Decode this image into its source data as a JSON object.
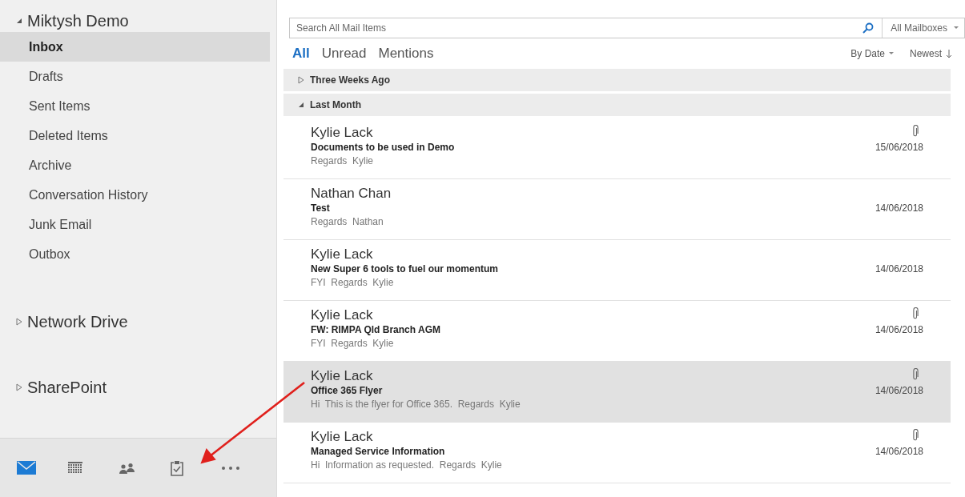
{
  "sidebar": {
    "accounts": [
      {
        "name": "Miktysh Demo",
        "expanded": true,
        "folders": [
          {
            "label": "Inbox",
            "selected": true
          },
          {
            "label": "Drafts",
            "selected": false
          },
          {
            "label": "Sent Items",
            "selected": false
          },
          {
            "label": "Deleted Items",
            "selected": false
          },
          {
            "label": "Archive",
            "selected": false
          },
          {
            "label": "Conversation History",
            "selected": false
          },
          {
            "label": "Junk Email",
            "selected": false
          },
          {
            "label": "Outbox",
            "selected": false
          }
        ]
      },
      {
        "name": "Network Drive",
        "expanded": false
      },
      {
        "name": "SharePoint",
        "expanded": false
      }
    ]
  },
  "nav_bar": [
    {
      "kind": "mail",
      "selected": true
    },
    {
      "kind": "calendar",
      "selected": false
    },
    {
      "kind": "people",
      "selected": false
    },
    {
      "kind": "tasks",
      "selected": false
    },
    {
      "kind": "more",
      "selected": false
    }
  ],
  "search": {
    "placeholder": "Search All Mail Items",
    "scope": "All Mailboxes"
  },
  "filters": [
    {
      "label": "All",
      "selected": true
    },
    {
      "label": "Unread",
      "selected": false
    },
    {
      "label": "Mentions",
      "selected": false
    }
  ],
  "sort": {
    "by": "By Date",
    "order": "Newest"
  },
  "groups": [
    {
      "label": "Three Weeks Ago",
      "expanded": false
    },
    {
      "label": "Last Month",
      "expanded": true,
      "messages": [
        {
          "sender": "Kylie Lack",
          "subject": "Documents to be used in Demo",
          "preview": "Regards  Kylie",
          "date": "15/06/2018",
          "attachment": true,
          "selected": false
        },
        {
          "sender": "Nathan Chan",
          "subject": "Test",
          "preview": "Regards  Nathan",
          "date": "14/06/2018",
          "attachment": false,
          "selected": false
        },
        {
          "sender": "Kylie Lack",
          "subject": "New Super 6 tools to fuel our momentum",
          "preview": "FYI  Regards  Kylie",
          "date": "14/06/2018",
          "attachment": false,
          "selected": false
        },
        {
          "sender": "Kylie Lack",
          "subject": "FW: RIMPA Qld Branch AGM",
          "preview": "FYI  Regards  Kylie",
          "date": "14/06/2018",
          "attachment": true,
          "selected": false
        },
        {
          "sender": "Kylie Lack",
          "subject": "Office 365 Flyer",
          "preview": "Hi  This is the flyer for Office 365.  Regards  Kylie",
          "date": "14/06/2018",
          "attachment": true,
          "selected": true
        },
        {
          "sender": "Kylie Lack",
          "subject": "Managed Service Information",
          "preview": "Hi  Information as requested.  Regards  Kylie",
          "date": "14/06/2018",
          "attachment": true,
          "selected": false
        }
      ]
    }
  ]
}
